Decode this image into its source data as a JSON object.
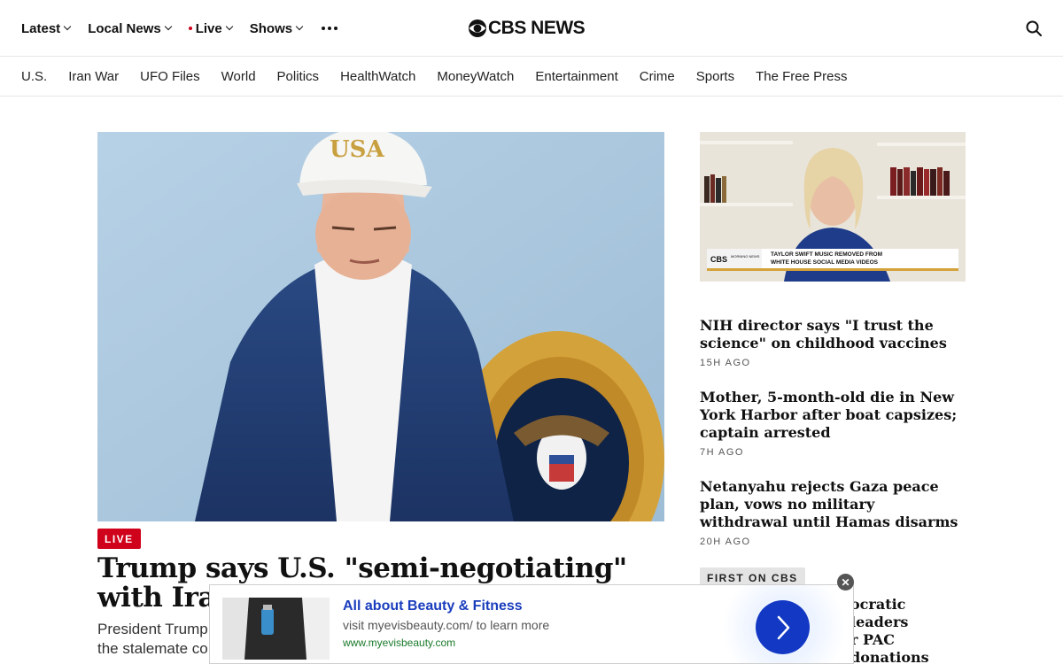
{
  "topnav": {
    "items": [
      {
        "label": "Latest"
      },
      {
        "label": "Local News"
      },
      {
        "label": "Live"
      },
      {
        "label": "Shows"
      }
    ],
    "more_icon": "more-dots-icon",
    "search_icon": "search-icon"
  },
  "logo": {
    "text": "CBS NEWS",
    "icon": "cbs-eye-icon"
  },
  "secnav": {
    "items": [
      {
        "label": "U.S."
      },
      {
        "label": "Iran War"
      },
      {
        "label": "UFO Files"
      },
      {
        "label": "World"
      },
      {
        "label": "Politics"
      },
      {
        "label": "HealthWatch"
      },
      {
        "label": "MoneyWatch"
      },
      {
        "label": "Entertainment"
      },
      {
        "label": "Crime"
      },
      {
        "label": "Sports"
      },
      {
        "label": "The Free Press"
      }
    ]
  },
  "hero": {
    "badge": "LIVE",
    "title": "Trump says U.S. \"semi-negotiating\" with Iran afte",
    "dek_line1": "President Trump",
    "dek_line2": "the stalemate co",
    "image_caption_hat": "USA"
  },
  "video": {
    "lower_third": "TAYLOR SWIFT MUSIC REMOVED FROM WHITE HOUSE SOCIAL MEDIA VIDEOS",
    "lower_third_line1": "TAYLOR SWIFT MUSIC REMOVED FROM",
    "lower_third_line2": "WHITE HOUSE SOCIAL MEDIA VIDEOS",
    "bug_line1": "CBS",
    "bug_line2": "MORNING NEWS"
  },
  "stories": [
    {
      "title": "NIH director says \"I trust the science\" on childhood vaccines",
      "time": "15H AGO"
    },
    {
      "title": "Mother, 5-month-old die in New York Harbor after boat capsizes; captain arrested",
      "time": "7H AGO"
    },
    {
      "title": "Netanyahu rejects Gaza peace plan, vows no military withdrawal until Hamas disarms",
      "time": "20H AGO"
    }
  ],
  "story4": {
    "badge": "FIRST ON CBS",
    "title_line1": "ocratic leaders",
    "title_line2": "r PAC donations"
  },
  "ad": {
    "headline": "All about Beauty & Fitness",
    "description": "visit myevisbeauty.com/ to learn more",
    "url": "www.myevisbeauty.com",
    "cta_icon": "chevron-right-icon",
    "close_label": "✕"
  },
  "colors": {
    "live_red": "#d0021b",
    "ad_blue": "#1238c4",
    "ad_link": "#1a3dbd",
    "ad_url_green": "#1a7a2a"
  }
}
